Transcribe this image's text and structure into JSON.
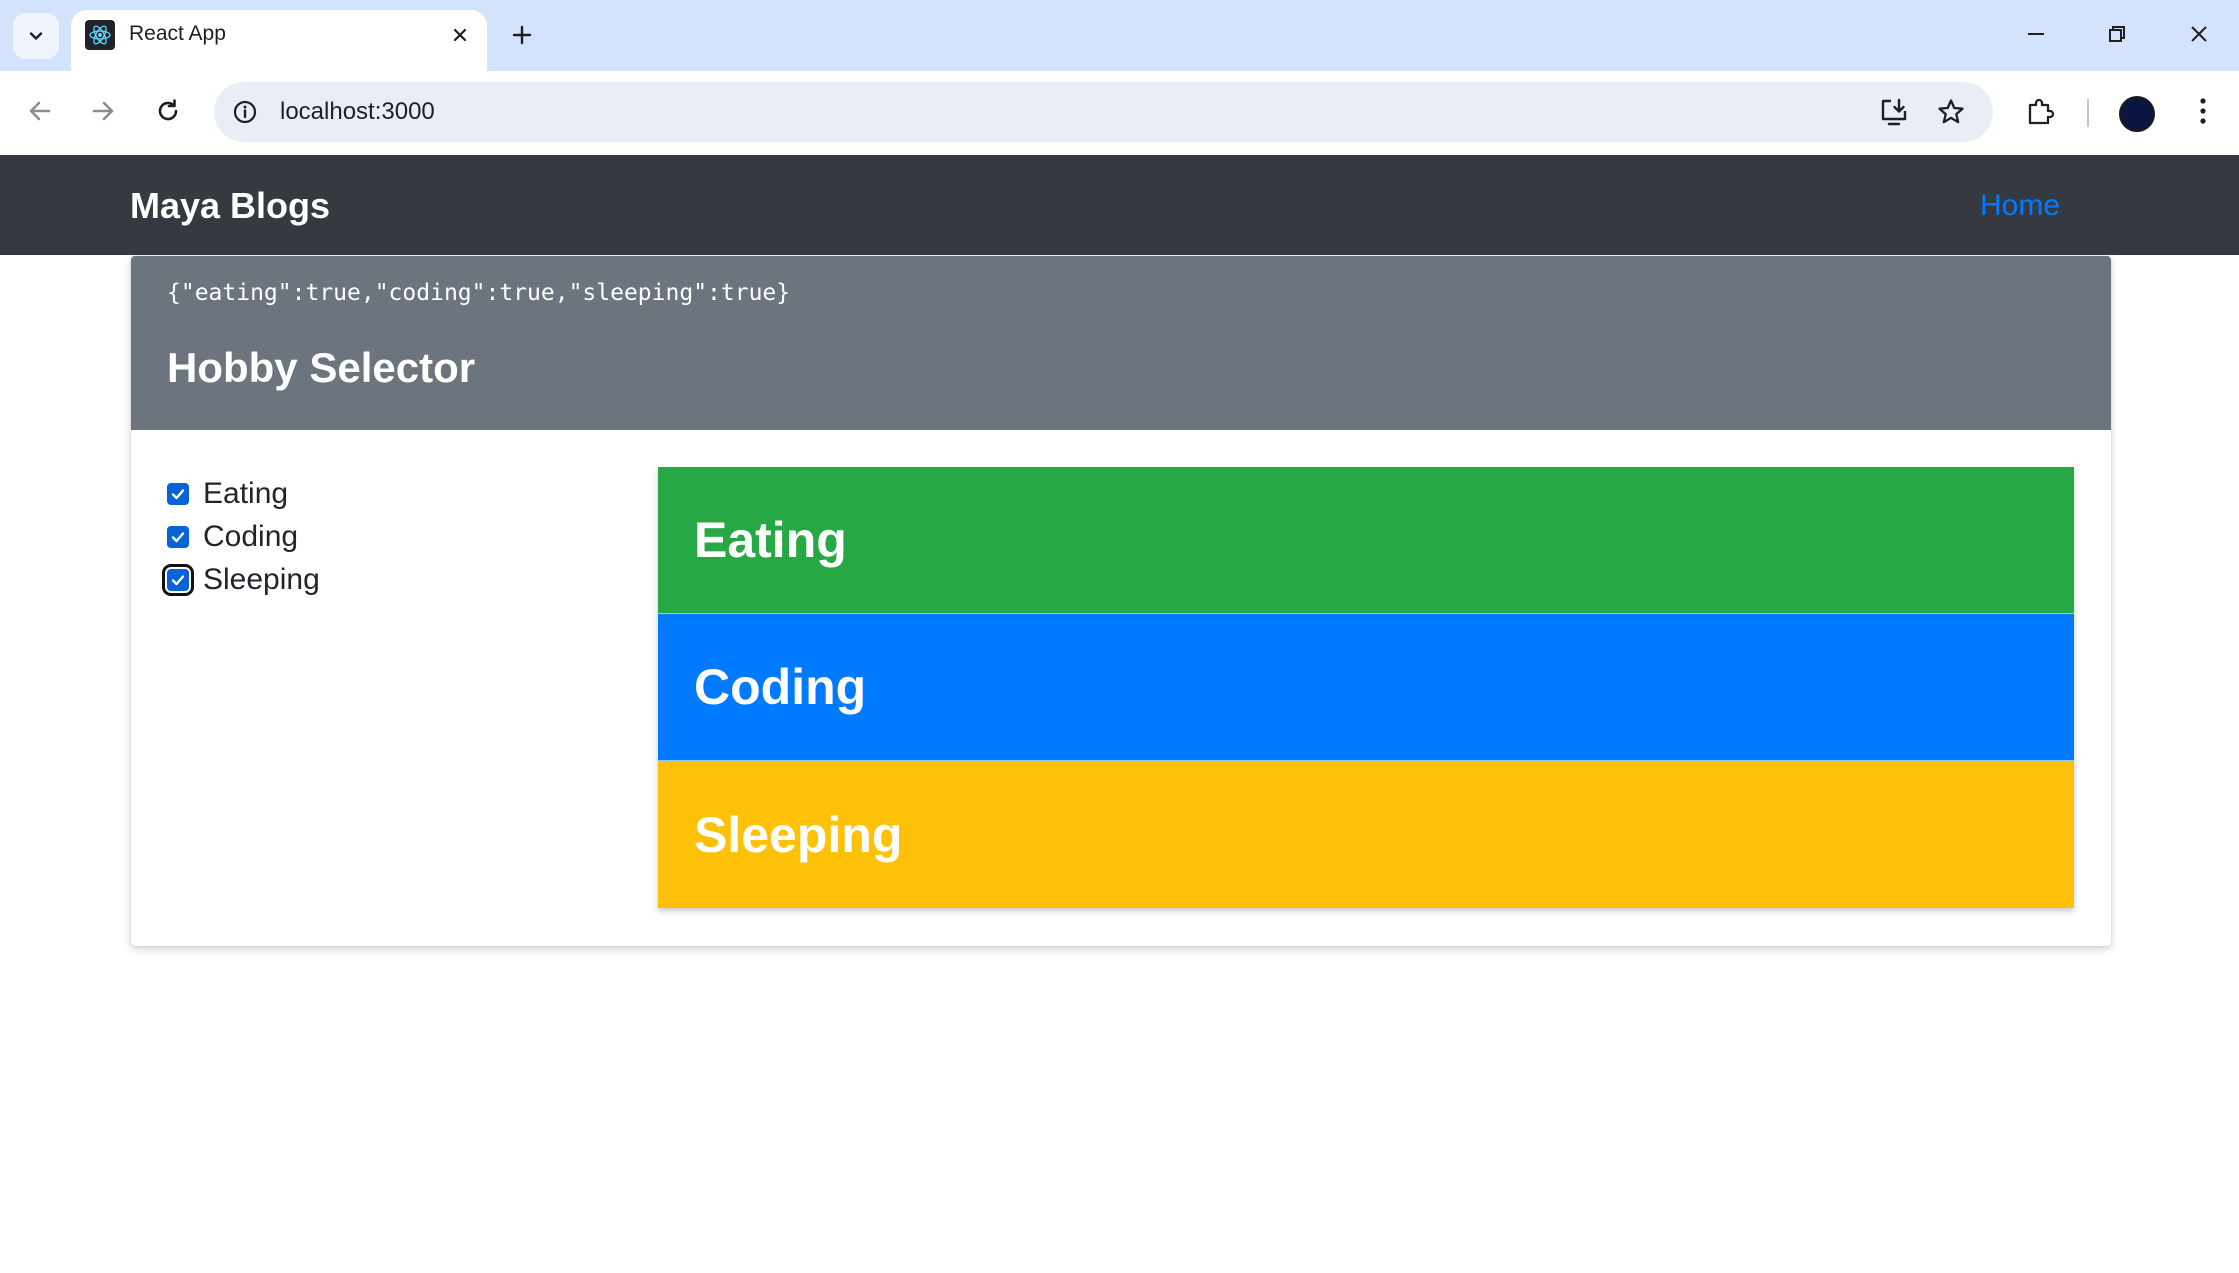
{
  "browser": {
    "tab_title": "React App",
    "url": "localhost:3000"
  },
  "icons": {
    "tab_search": "chevron-down-icon",
    "favicon": "react-logo-icon",
    "tab_close": "close-icon",
    "new_tab": "plus-icon",
    "minimize": "minimize-icon",
    "restore": "restore-icon",
    "close_window": "close-icon",
    "back": "arrow-left-icon",
    "forward": "arrow-right-icon",
    "reload": "reload-icon",
    "site_info": "info-icon",
    "install": "install-app-icon",
    "bookmark": "star-icon",
    "extensions": "puzzle-icon",
    "profile": "avatar",
    "menu": "kebab-menu-icon"
  },
  "navbar": {
    "brand": "Maya Blogs",
    "links": [
      {
        "label": "Home"
      }
    ]
  },
  "card": {
    "state_json": "{\"eating\":true,\"coding\":true,\"sleeping\":true}",
    "title": "Hobby Selector"
  },
  "hobbies": [
    {
      "label": "Eating",
      "checked": true,
      "color": "#28a745"
    },
    {
      "label": "Coding",
      "checked": true,
      "color": "#007bff"
    },
    {
      "label": "Sleeping",
      "checked": true,
      "color": "#ffc107",
      "focused": true
    }
  ],
  "colors": {
    "navbar_bg": "#343a40",
    "header_bg": "#6c757d",
    "link": "#007bff",
    "checkbox": "#0a62d8"
  }
}
